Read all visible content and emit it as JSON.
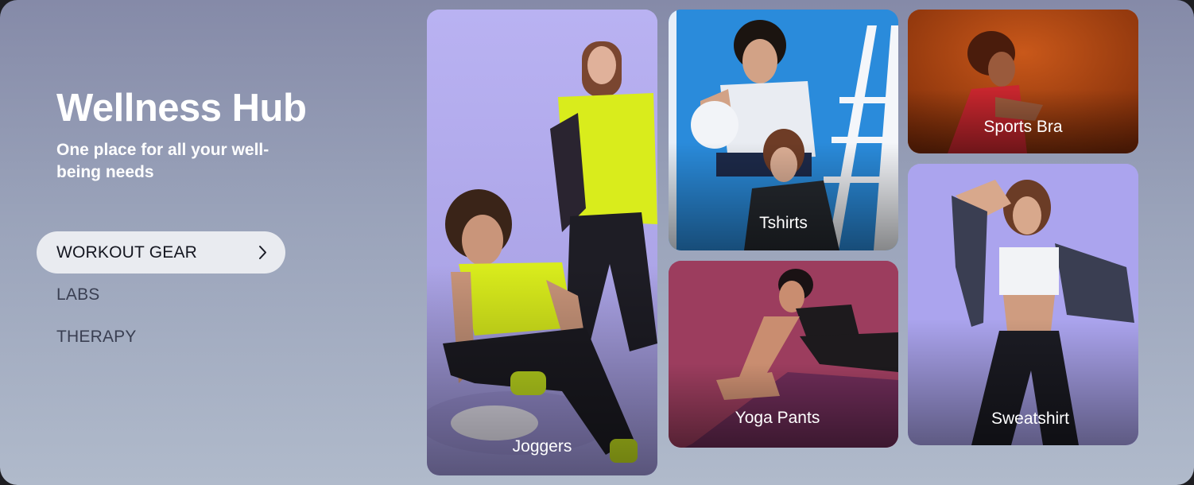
{
  "hero": {
    "title": "Wellness Hub",
    "subtitle": "One place for all your well-being needs"
  },
  "nav": {
    "items": [
      {
        "label": "WORKOUT GEAR",
        "active": true
      },
      {
        "label": "LABS",
        "active": false
      },
      {
        "label": "THERAPY",
        "active": false
      }
    ]
  },
  "cards": {
    "joggers": {
      "label": "Joggers"
    },
    "tshirts": {
      "label": "Tshirts"
    },
    "yoga": {
      "label": "Yoga Pants"
    },
    "bra": {
      "label": "Sports Bra"
    },
    "sweat": {
      "label": "Sweatshirt"
    }
  },
  "colors": {
    "panel_top": "#858aa8",
    "panel_bottom": "#b0bacb",
    "active_pill": "#e9ebf0",
    "neon": "#d9ec1c"
  },
  "icons": {
    "nav_active": "chevron-right-icon"
  }
}
